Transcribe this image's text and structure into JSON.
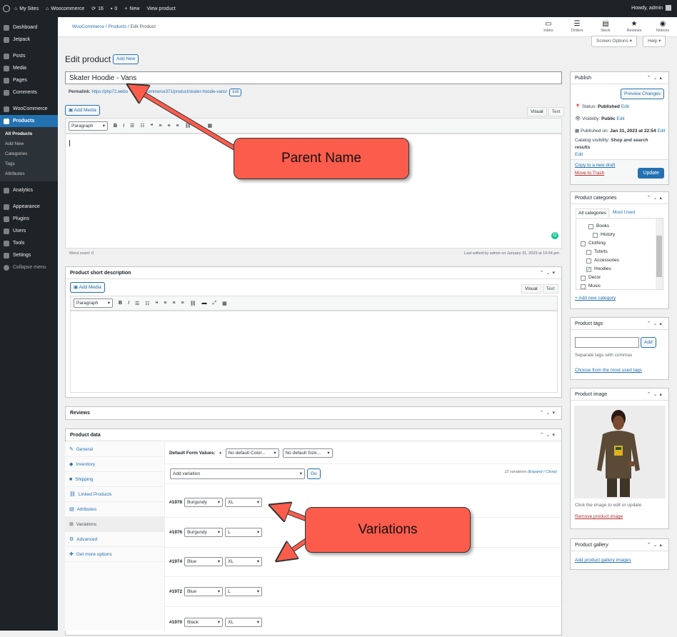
{
  "admin_bar": {
    "site": "My Sites",
    "store": "Woocommerce",
    "updates": "16",
    "comments": "0",
    "new": "New",
    "view": "View product",
    "howdy": "Howdy, admin"
  },
  "sidebar": {
    "items": [
      {
        "label": "Dashboard"
      },
      {
        "label": "Jetpack"
      },
      {
        "label": "Posts"
      },
      {
        "label": "Media"
      },
      {
        "label": "Pages"
      },
      {
        "label": "Comments"
      },
      {
        "label": "WooCommerce"
      },
      {
        "label": "Products"
      },
      {
        "label": "Analytics"
      },
      {
        "label": "Appearance"
      },
      {
        "label": "Plugins"
      },
      {
        "label": "Users"
      },
      {
        "label": "Tools"
      },
      {
        "label": "Settings"
      },
      {
        "label": "Collapse menu"
      }
    ],
    "sub": [
      "All Products",
      "Add New",
      "Categories",
      "Tags",
      "Attributes"
    ]
  },
  "breadcrumb": {
    "woo": "WooCommerce",
    "products": "Products",
    "current": "Edit Product"
  },
  "top_tools": [
    {
      "label": "Inbox",
      "icon": "inbox-icon"
    },
    {
      "label": "Orders",
      "icon": "orders-icon"
    },
    {
      "label": "Stock",
      "icon": "stock-icon"
    },
    {
      "label": "Reviews",
      "icon": "star-icon"
    },
    {
      "label": "Notices",
      "icon": "wordpress-icon"
    }
  ],
  "screen_options": "Screen Options",
  "help": "Help",
  "page": {
    "title": "Edit product",
    "add_new": "Add New"
  },
  "product": {
    "name": "Skater Hoodie - Vans",
    "permalink_label": "Permalink:",
    "permalink_start": "https://php72.webo",
    "permalink_end": "/woocommerce371/product/skater-hoodie-vans/",
    "permalink_edit": "Edit"
  },
  "editor": {
    "add_media": "Add Media",
    "tab_visual": "Visual",
    "tab_text": "Text",
    "format": "Paragraph",
    "word_count": "Word count: 0",
    "last_edited": "Last edited by admin on January 31, 2023 at 10:54 pm"
  },
  "short_desc": {
    "title": "Product short description",
    "add_media": "Add Media",
    "tab_visual": "Visual",
    "tab_text": "Text",
    "format": "Paragraph"
  },
  "reviews": {
    "title": "Reviews"
  },
  "product_data": {
    "title": "Product data",
    "tabs": [
      "General",
      "Inventory",
      "Shipping",
      "Linked Products",
      "Attributes",
      "Variations",
      "Advanced",
      "Get more options"
    ],
    "default_form_label": "Default Form Values:",
    "default_color": "No default Color...",
    "default_size": "No default Size...",
    "add_variation": "Add variation",
    "go": "Go",
    "count": "12 variations",
    "expand_close": "(Expand / Close)",
    "variations": [
      {
        "id": "#1978",
        "color": "Burgundy",
        "size": "XL"
      },
      {
        "id": "#1976",
        "color": "Burgundy",
        "size": "L"
      },
      {
        "id": "#1974",
        "color": "Blue",
        "size": "XL"
      },
      {
        "id": "#1972",
        "color": "Blue",
        "size": "L"
      },
      {
        "id": "#1970",
        "color": "Black",
        "size": "XL"
      }
    ]
  },
  "publish": {
    "title": "Publish",
    "preview": "Preview Changes",
    "status_label": "Status:",
    "status": "Published",
    "visibility_label": "Visibility:",
    "visibility": "Public",
    "published_on": "Published on:",
    "published_date": "Jan 31, 2023 at 22:54",
    "edit": "Edit",
    "catalog_label": "Catalog visibility:",
    "catalog": "Shop and search results",
    "copy_draft": "Copy to a new draft",
    "trash": "Move to Trash",
    "update": "Update"
  },
  "categories": {
    "title": "Product categories",
    "tab_all": "All categories",
    "tab_used": "Most Used",
    "items": [
      {
        "name": "Books",
        "checked": false
      },
      {
        "name": "History",
        "checked": false
      },
      {
        "name": "Clothing",
        "checked": false
      },
      {
        "name": "Tshirts",
        "checked": false
      },
      {
        "name": "Accessories",
        "checked": false
      },
      {
        "name": "Hoodies",
        "checked": true
      },
      {
        "name": "Decor",
        "checked": false
      },
      {
        "name": "Music",
        "checked": false
      }
    ],
    "add_new": "+ Add new category"
  },
  "tags": {
    "title": "Product tags",
    "add": "Add",
    "hint": "Separate tags with commas",
    "choose": "Choose from the most used tags"
  },
  "image": {
    "title": "Product image",
    "hint": "Click the image to edit or update",
    "remove": "Remove product image"
  },
  "gallery": {
    "title": "Product gallery",
    "add": "Add product gallery images"
  },
  "annotations": {
    "parent": "Parent Name",
    "variations": "Variations"
  }
}
